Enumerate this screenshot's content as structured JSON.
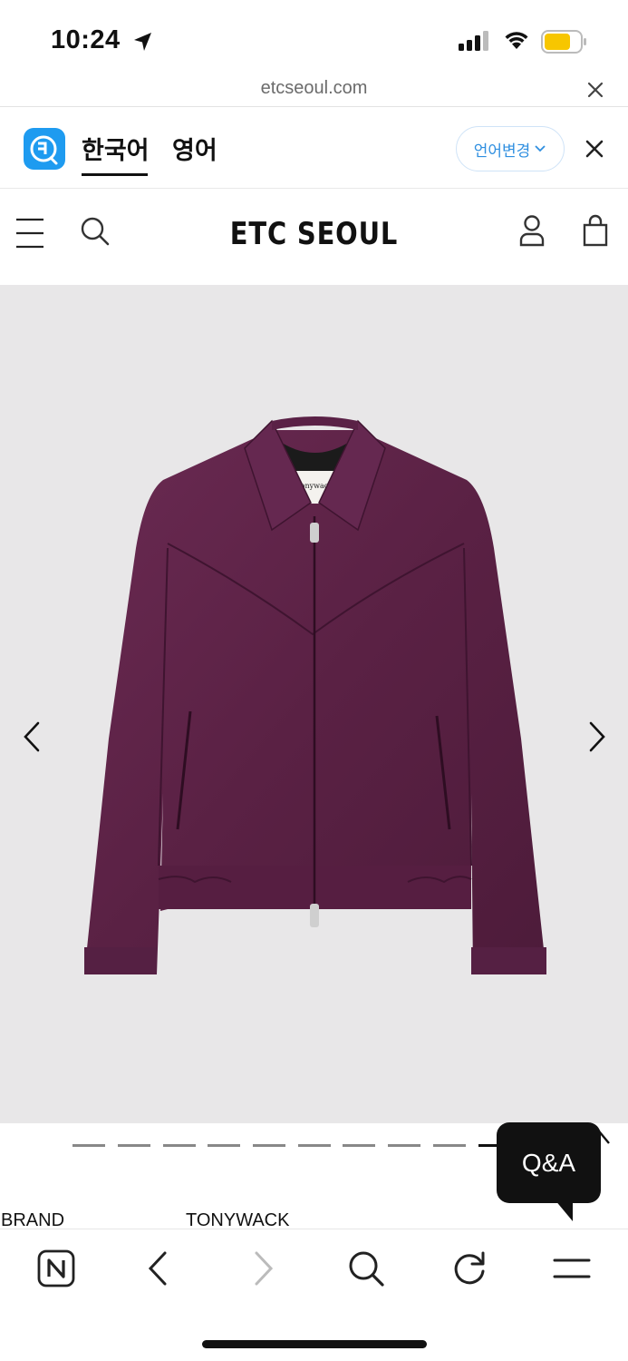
{
  "status_bar": {
    "time": "10:24",
    "icons": [
      "location-arrow-icon",
      "cellular-signal-icon",
      "wifi-icon",
      "battery-icon"
    ],
    "battery_color": "#f7c600"
  },
  "url_bar": {
    "url": "etcseoul.com"
  },
  "translate_bar": {
    "language_active": "한국어",
    "language_other": "영어",
    "change_label": "언어변경",
    "accent_color": "#2f8fe0"
  },
  "site_header": {
    "brand": "ETC SEOUL",
    "icons": [
      "menu-icon",
      "search-icon",
      "user-icon",
      "shopping-bag-icon"
    ]
  },
  "product": {
    "image_description_icon": "jacket-image",
    "jacket_color": "#5e2449",
    "label_text": "Tonywack",
    "pager_count": 11,
    "pager_active_index": 10
  },
  "qa": {
    "label": "Q&A"
  },
  "info": {
    "label": "BRAND",
    "value": "TONYWACK"
  },
  "bottom_toolbar": {
    "icons": [
      "naver-home-icon",
      "back-icon",
      "forward-icon",
      "search-icon",
      "reload-icon",
      "menu-icon"
    ]
  }
}
